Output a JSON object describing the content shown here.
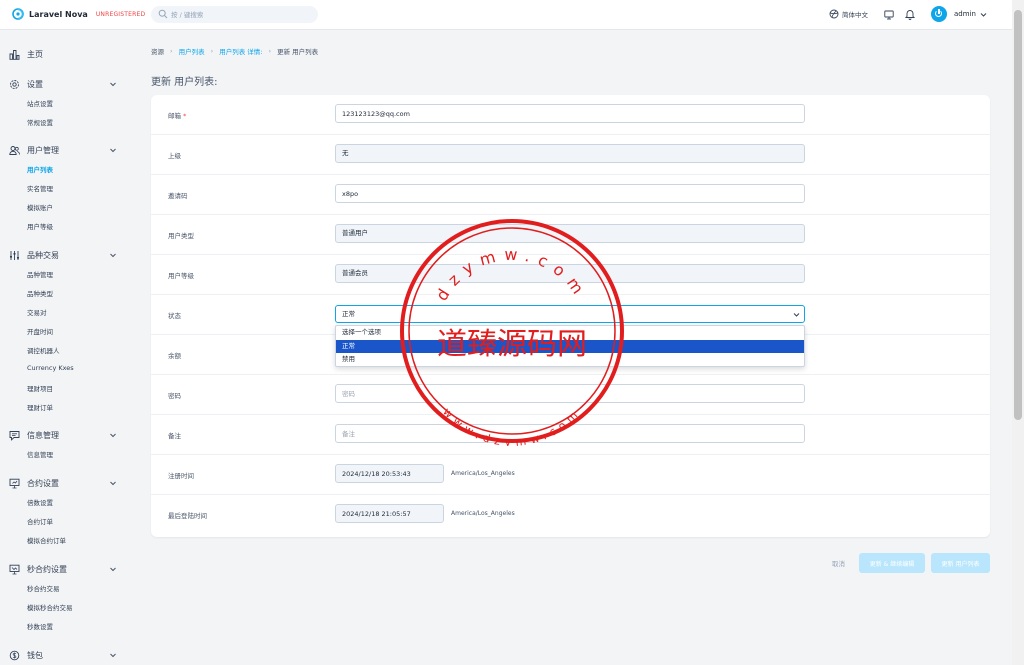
{
  "app": {
    "brand_name": "Laravel Nova",
    "brand_tag": "UNREGISTERED",
    "search_placeholder": "按 / 键搜索",
    "language": "简体中文",
    "user_name": "admin",
    "accent_color": "#0ea5e9"
  },
  "sidebar": {
    "home": "主页",
    "sections": [
      {
        "label": "设置",
        "icon": "gear-icon",
        "items": [
          "站点设置",
          "常规设置"
        ]
      },
      {
        "label": "用户管理",
        "icon": "users-icon",
        "items": [
          "用户列表",
          "实名管理",
          "模拟账户",
          "用户等级"
        ]
      },
      {
        "label": "品种交易",
        "icon": "sliders-icon",
        "items": [
          "品种管理",
          "品种类型",
          "交易对",
          "开盘时间",
          "调控机器人",
          "Currency Kxes",
          "理财项目",
          "理财订单"
        ]
      },
      {
        "label": "信息管理",
        "icon": "message-icon",
        "items": [
          "信息管理"
        ]
      },
      {
        "label": "合约设置",
        "icon": "presentation-icon",
        "items": [
          "倍数设置",
          "合约订单",
          "模拟合约订单"
        ]
      },
      {
        "label": "秒合约设置",
        "icon": "chart-icon",
        "items": [
          "秒合约交易",
          "模拟秒合约交易",
          "秒数设置"
        ]
      },
      {
        "label": "钱包",
        "icon": "dollar-icon",
        "items": []
      }
    ],
    "active_item": "用户列表"
  },
  "breadcrumb": [
    "资源",
    "用户列表",
    "用户列表 详情:",
    "更新 用户列表"
  ],
  "page_title": "更新 用户列表:",
  "form": {
    "email_label": "邮箱",
    "email_required": "*",
    "email_value": "123123123@qq.com",
    "parent_label": "上级",
    "parent_value": "无",
    "invite_label": "邀请码",
    "invite_value": "x8po",
    "user_type_label": "用户类型",
    "user_type_value": "普通用户",
    "user_level_label": "用户等级",
    "user_level_value": "普通会员",
    "status_label": "状态",
    "status_value": "正常",
    "status_options": [
      "选择一个选项",
      "正常",
      "禁用"
    ],
    "balance_label": "余额",
    "password_label": "密码",
    "password_placeholder": "密码",
    "remark_label": "备注",
    "remark_placeholder": "备注",
    "register_time_label": "注册时间",
    "register_time_value": "2024/12/18 20:53:43",
    "register_tz": "America/Los_Angeles",
    "last_login_label": "最后登陆时间",
    "last_login_value": "2024/12/18 21:05:57",
    "last_login_tz": "America/Los_Angeles"
  },
  "footer": {
    "cancel": "取消",
    "update_continue": "更新 & 继续编辑",
    "update": "更新 用户列表"
  },
  "watermark": {
    "center_text": "道臻源码网",
    "top_text": "dzymw.com",
    "bottom_text": "www.dzymw.com",
    "color": "#e11d1d"
  }
}
